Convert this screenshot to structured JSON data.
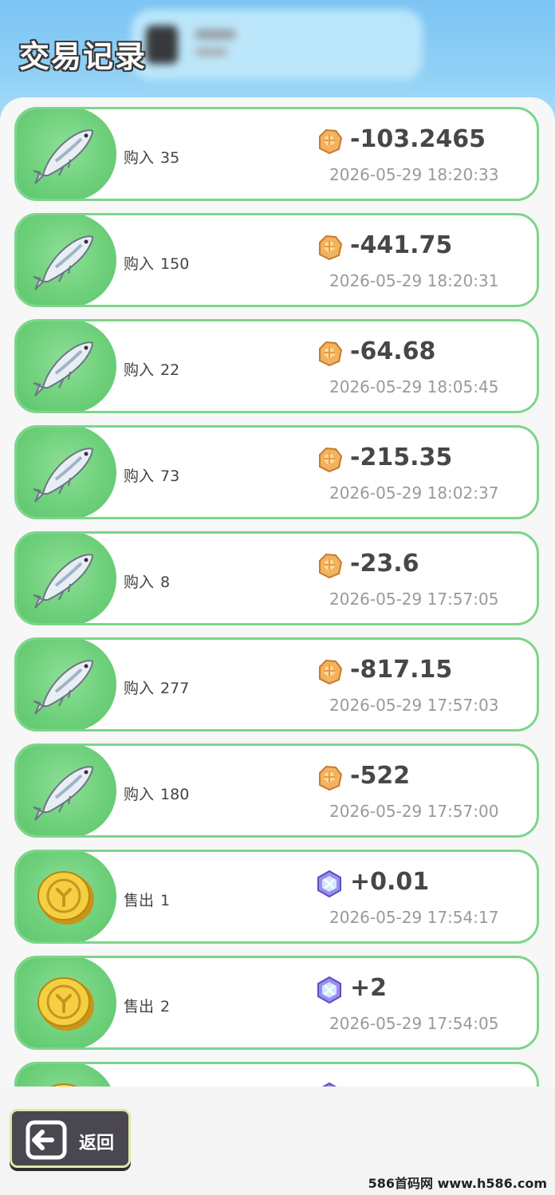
{
  "header": {
    "title": "交易记录"
  },
  "rows": [
    {
      "type": "buy",
      "action": "购入",
      "qty": "35",
      "currency_icon": "gold-ore-icon",
      "amount": "-103.2465",
      "time": "2026-05-29 18:20:33"
    },
    {
      "type": "buy",
      "action": "购入",
      "qty": "150",
      "currency_icon": "gold-ore-icon",
      "amount": "-441.75",
      "time": "2026-05-29 18:20:31"
    },
    {
      "type": "buy",
      "action": "购入",
      "qty": "22",
      "currency_icon": "gold-ore-icon",
      "amount": "-64.68",
      "time": "2026-05-29 18:05:45"
    },
    {
      "type": "buy",
      "action": "购入",
      "qty": "73",
      "currency_icon": "gold-ore-icon",
      "amount": "-215.35",
      "time": "2026-05-29 18:02:37"
    },
    {
      "type": "buy",
      "action": "购入",
      "qty": "8",
      "currency_icon": "gold-ore-icon",
      "amount": "-23.6",
      "time": "2026-05-29 17:57:05"
    },
    {
      "type": "buy",
      "action": "购入",
      "qty": "277",
      "currency_icon": "gold-ore-icon",
      "amount": "-817.15",
      "time": "2026-05-29 17:57:03"
    },
    {
      "type": "buy",
      "action": "购入",
      "qty": "180",
      "currency_icon": "gold-ore-icon",
      "amount": "-522",
      "time": "2026-05-29 17:57:00"
    },
    {
      "type": "sell",
      "action": "售出",
      "qty": "1",
      "currency_icon": "crystal-gem-icon",
      "amount": "+0.01",
      "time": "2026-05-29 17:54:17"
    },
    {
      "type": "sell",
      "action": "售出",
      "qty": "2",
      "currency_icon": "crystal-gem-icon",
      "amount": "+2",
      "time": "2026-05-29 17:54:05"
    },
    {
      "type": "sell",
      "action": "",
      "qty": "",
      "currency_icon": "crystal-gem-icon",
      "amount": "",
      "time": ""
    }
  ],
  "footer": {
    "back_label": "返回"
  },
  "watermark": "586首码网 www.h586.com",
  "colors": {
    "row_border": "#7cd58a",
    "icon_bg": "#6ed07b",
    "header_bg": "#7cc4f3"
  }
}
